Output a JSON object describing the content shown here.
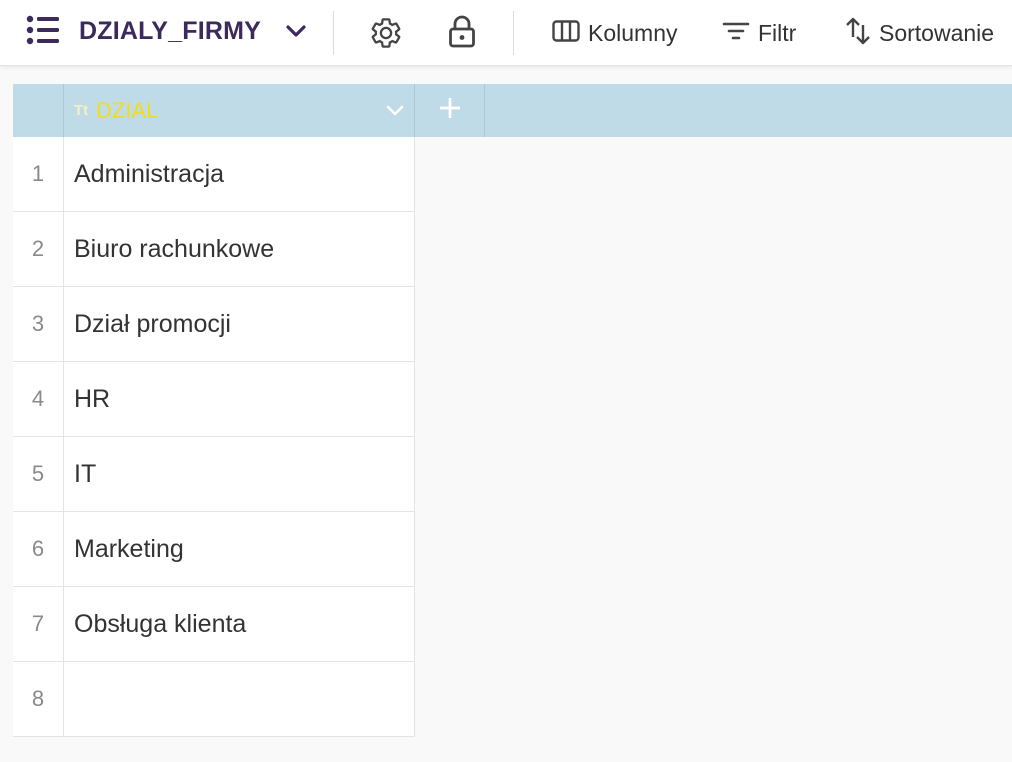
{
  "toolbar": {
    "table_title": "DZIALY_FIRMY",
    "columns_label": "Kolumny",
    "filter_label": "Filtr",
    "sort_label": "Sortowanie"
  },
  "grid": {
    "columns": [
      {
        "name": "DZIAL",
        "type_icon": "Tt"
      }
    ],
    "rows": [
      {
        "num": "1",
        "dzial": "Administracja"
      },
      {
        "num": "2",
        "dzial": "Biuro rachunkowe"
      },
      {
        "num": "3",
        "dzial": "Dział promocji"
      },
      {
        "num": "4",
        "dzial": "HR"
      },
      {
        "num": "5",
        "dzial": "IT"
      },
      {
        "num": "6",
        "dzial": "Marketing"
      },
      {
        "num": "7",
        "dzial": "Obsługa klienta"
      },
      {
        "num": "8",
        "dzial": ""
      }
    ]
  },
  "colors": {
    "title": "#3d2a5c",
    "header_bg": "#bfdbe7",
    "column_name": "#f2dc1c"
  },
  "icons": {
    "menu": "list-icon",
    "title_dropdown": "chevron-down-icon",
    "settings": "gear-icon",
    "lock": "lock-icon",
    "columns": "columns-icon",
    "filter": "filter-icon",
    "sort": "sort-arrows-icon",
    "column_type": "text-type-icon",
    "column_menu": "chevron-down-icon",
    "add_column": "plus-icon"
  }
}
